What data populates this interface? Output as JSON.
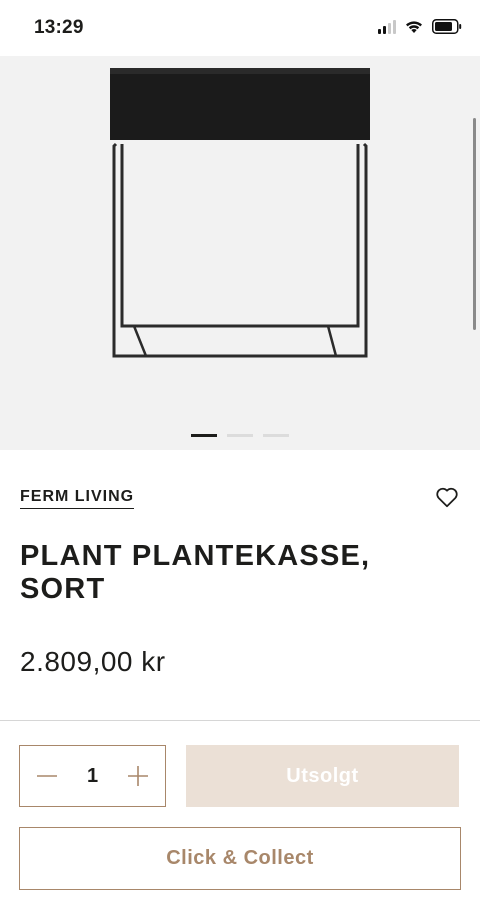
{
  "status_bar": {
    "time": "13:29"
  },
  "gallery": {
    "image_name": "plant-box-black",
    "slide_count": 3,
    "active_slide": 1
  },
  "product": {
    "brand": "FERM LIVING",
    "title": "PLANT PLANTEKASSE, SORT",
    "price": "2.809,00 kr"
  },
  "purchase": {
    "quantity": "1",
    "soldout_label": "Utsolgt",
    "click_collect_label": "Click & Collect"
  },
  "colors": {
    "accent": "#a8876a",
    "soldout_bg": "#ebe0d6",
    "text": "#1d1d1b",
    "gallery_bg": "#f2f2f2"
  },
  "icons": [
    "signal-icon",
    "wifi-icon",
    "battery-icon",
    "heart-icon",
    "minus-icon",
    "plus-icon"
  ]
}
